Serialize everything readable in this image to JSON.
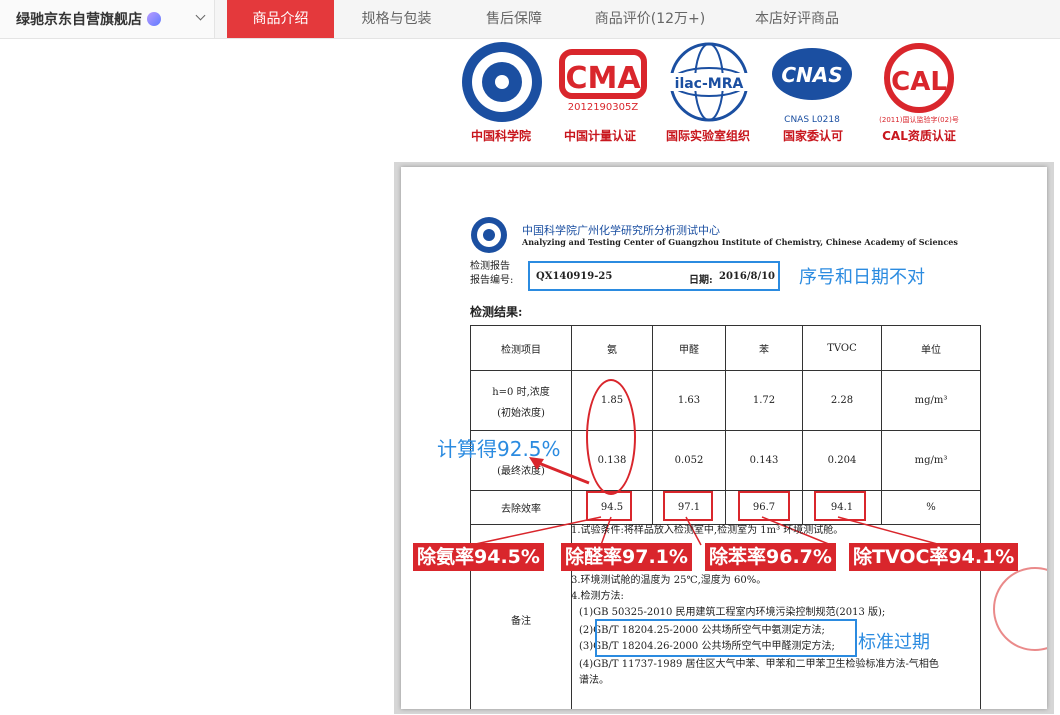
{
  "store": {
    "name": "绿驰京东自营旗舰店"
  },
  "tabs": [
    {
      "label": "商品介绍",
      "active": true
    },
    {
      "label": "规格与包装",
      "active": false
    },
    {
      "label": "售后保障",
      "active": false
    },
    {
      "label": "商品评价(12万+)",
      "active": false
    },
    {
      "label": "本店好评商品",
      "active": false
    }
  ],
  "logos": [
    {
      "caption": "中国科学院",
      "text": "CHINESE ACADEMY OF SCIENCES"
    },
    {
      "caption": "中国计量认证",
      "text": "CMA",
      "sub": "2012190305Z"
    },
    {
      "caption": "国际实验室组织",
      "text": "ilac-MRA"
    },
    {
      "caption": "国家委认可",
      "text": "CNAS",
      "sub": "CNAS L0218"
    },
    {
      "caption": "CAL资质认证",
      "text": "CAL",
      "sub": "(2011)国认监验字(02)号"
    }
  ],
  "report": {
    "org_cn": "中国科学院广州化学研究所分析测试中心",
    "org_en": "Analyzing and Testing Center of Guangzhou Institute of Chemistry, Chinese Academy of Sciences",
    "title": "检测报告",
    "no_label": "报告编号:",
    "no_value": "QX140919-25",
    "date_label": "日期:",
    "date_value": "2016/8/10",
    "results_label": "检测结果:",
    "table": {
      "headers": [
        "检测项目",
        "氨",
        "甲醛",
        "苯",
        "TVOC",
        "单位"
      ],
      "row1": {
        "label1": "h=0 时,浓度",
        "label2": "(初始浓度)",
        "values": [
          "1.85",
          "1.63",
          "1.72",
          "2.28"
        ],
        "unit": "mg/m³"
      },
      "row2": {
        "label": "(最终浓度)",
        "values": [
          "0.138",
          "0.052",
          "0.143",
          "0.204"
        ],
        "unit": "mg/m³"
      },
      "row3": {
        "label": "去除效率",
        "values": [
          "94.5",
          "97.1",
          "96.7",
          "94.1"
        ],
        "unit": "%"
      }
    },
    "notes_label": "备注",
    "notes": [
      "1.试验条件:将样品放入检测室中,检测室为 1m³ 环境测试舱。",
      "3.环境测试舱的温度为 25℃,湿度为 60%。",
      "4.检测方法:",
      "(1)GB 50325-2010 民用建筑工程室内环境污染控制规范(2013 版);",
      "(2)GB/T 18204.25-2000 公共场所空气中氨测定方法;",
      "(3)GB/T 18204.26-2000 公共场所空气中甲醛测定方法;",
      "(4)GB/T 11737-1989 居住区大气中苯、甲苯和二甲苯卫生检验标准方法-气相色",
      "谱法。"
    ]
  },
  "annotations": {
    "serial_date": "序号和日期不对",
    "calc": "计算得92.5%",
    "standard": "标准过期",
    "labels": [
      "除氨率94.5%",
      "除醛率97.1%",
      "除苯率96.7%",
      "除TVOC率94.1%"
    ]
  },
  "colors": {
    "accent": "#e4393c",
    "annotation_blue": "#2b8be0",
    "annotation_red": "#d9262c"
  }
}
